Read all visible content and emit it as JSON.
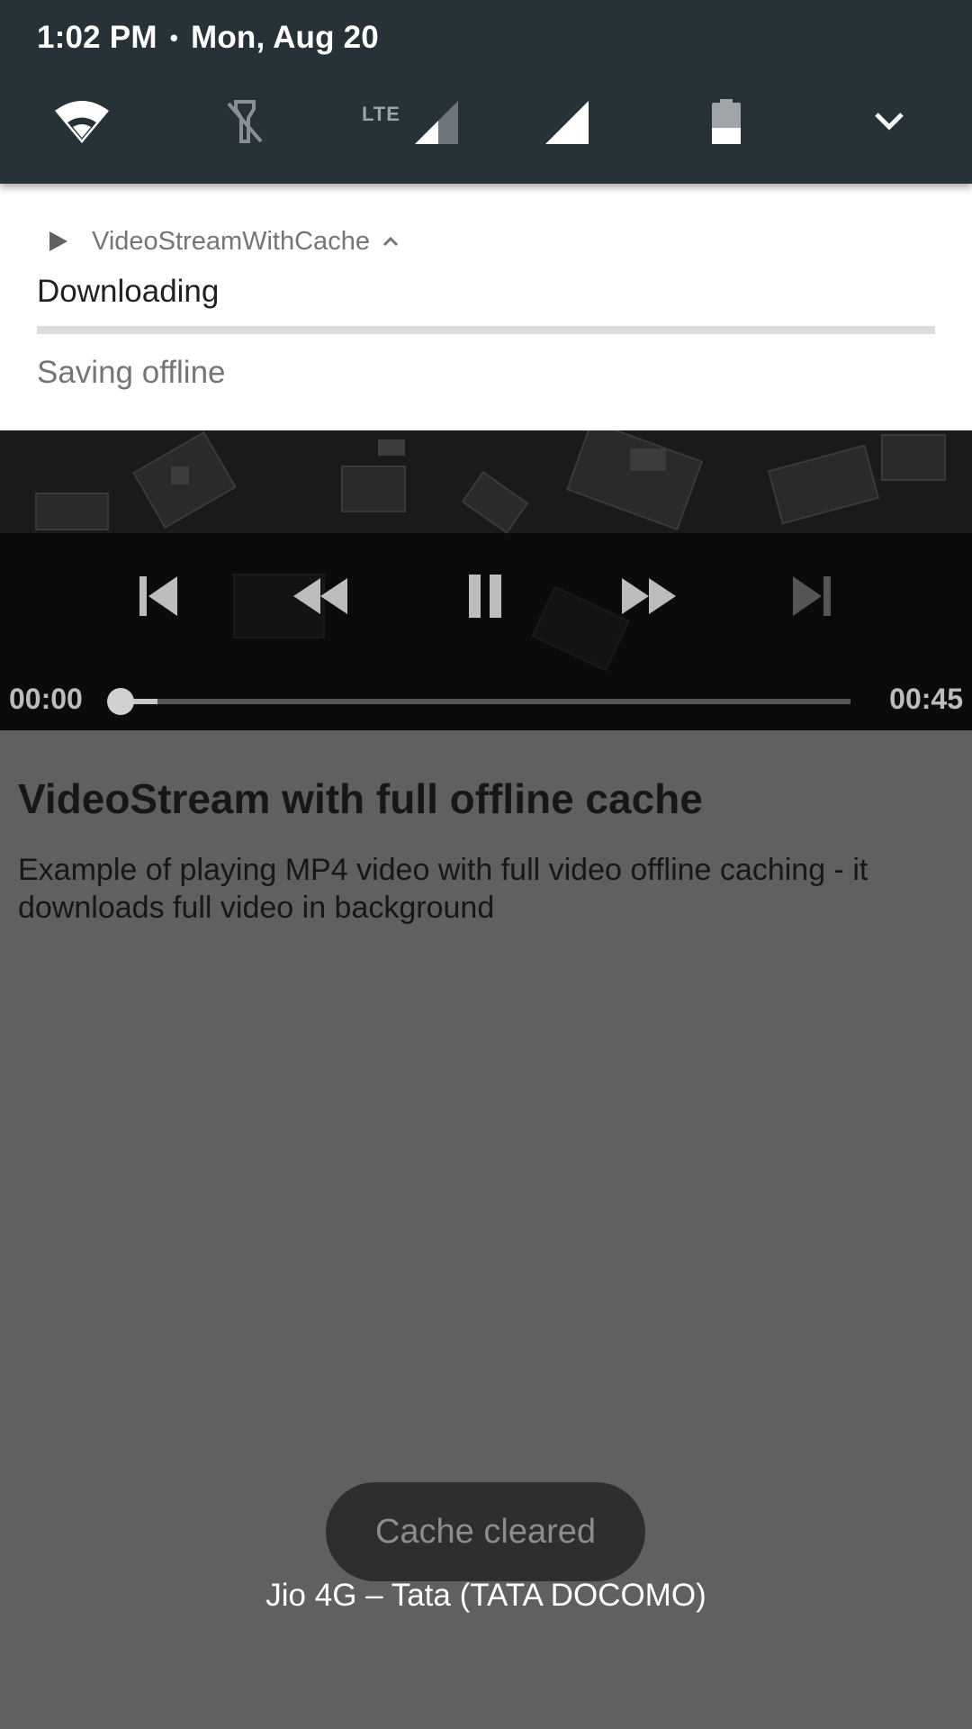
{
  "status_bar": {
    "time": "1:02 PM",
    "separator": "•",
    "date": "Mon, Aug 20",
    "lte_label": "LTE"
  },
  "quick_settings": {
    "tiles": [
      {
        "icon": "wifi-icon"
      },
      {
        "icon": "flashlight-off-icon"
      },
      {
        "icon": "lte-signal-icon"
      },
      {
        "icon": "signal-icon"
      },
      {
        "icon": "battery-icon"
      },
      {
        "icon": "chevron-down-icon"
      }
    ]
  },
  "notification": {
    "app_name": "VideoStreamWithCache",
    "title": "Downloading",
    "progress": 0,
    "subtitle": "Saving offline"
  },
  "player": {
    "current_time": "00:00",
    "duration": "00:45",
    "position_fraction": 0.0,
    "buffered_fraction": 0.05,
    "controls": [
      "previous-icon",
      "rewind-icon",
      "pause-icon",
      "fast-forward-icon",
      "next-icon"
    ]
  },
  "content": {
    "title": "VideoStream with full offline cache",
    "description": "Example of playing MP4 video with full video offline caching - it downloads full video in background"
  },
  "toast": {
    "message": "Cache cleared"
  },
  "carrier": {
    "text": "Jio 4G – Tata (TATA DOCOMO)"
  },
  "colors": {
    "shade_bg": "#263238",
    "scrim": "#606060",
    "toast_bg": "#2e2e2e"
  }
}
